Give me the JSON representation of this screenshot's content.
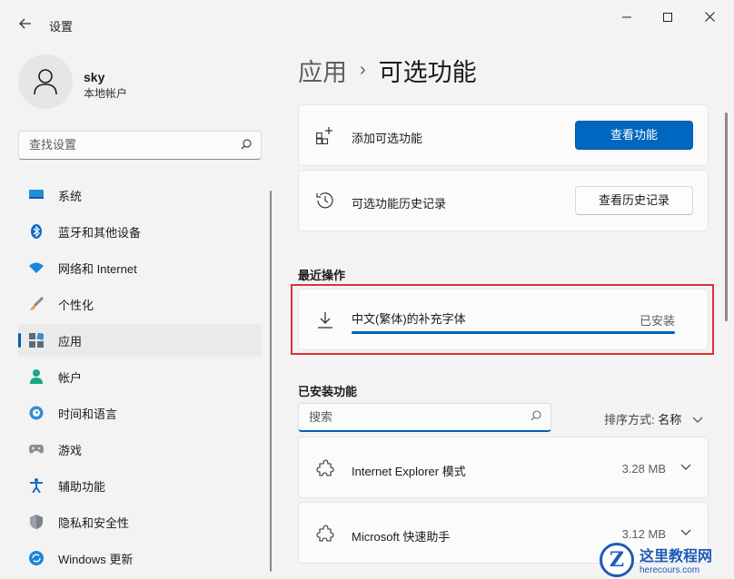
{
  "window": {
    "title": "设置",
    "back_icon": "back-arrow-icon",
    "minimize_glyph": "—",
    "maximize_glyph": "☐",
    "close_glyph": "✕"
  },
  "user": {
    "name": "sky",
    "account": "本地帐户"
  },
  "sidebar": {
    "search_placeholder": "查找设置",
    "items": [
      {
        "label": "系统",
        "icon": "monitor-icon"
      },
      {
        "label": "蓝牙和其他设备",
        "icon": "bluetooth-icon"
      },
      {
        "label": "网络和 Internet",
        "icon": "wifi-icon"
      },
      {
        "label": "个性化",
        "icon": "brush-icon"
      },
      {
        "label": "应用",
        "icon": "apps-icon",
        "active": true
      },
      {
        "label": "帐户",
        "icon": "person-icon"
      },
      {
        "label": "时间和语言",
        "icon": "globe-clock-icon"
      },
      {
        "label": "游戏",
        "icon": "gamepad-icon"
      },
      {
        "label": "辅助功能",
        "icon": "accessibility-icon"
      },
      {
        "label": "隐私和安全性",
        "icon": "shield-icon"
      },
      {
        "label": "Windows 更新",
        "icon": "update-icon"
      }
    ]
  },
  "breadcrumb": {
    "parent": "应用",
    "separator": "›",
    "current": "可选功能"
  },
  "add_feature": {
    "label": "添加可选功能",
    "button": "查看功能",
    "icon": "add-apps-icon"
  },
  "history": {
    "label": "可选功能历史记录",
    "button": "查看历史记录",
    "icon": "history-icon"
  },
  "recent": {
    "heading": "最近操作",
    "item": {
      "name": "中文(繁体)的补充字体",
      "status": "已安装",
      "progress": 1.0,
      "icon": "download-icon"
    }
  },
  "installed": {
    "heading": "已安装功能",
    "search_placeholder": "搜索",
    "sort_label": "排序方式:",
    "sort_value": "名称",
    "items": [
      {
        "name": "Internet Explorer 模式",
        "size": "3.28 MB",
        "icon": "puzzle-icon"
      },
      {
        "name": "Microsoft 快速助手",
        "size": "3.12 MB",
        "icon": "puzzle-icon"
      }
    ]
  },
  "watermark": {
    "logo_letter": "Z",
    "title": "这里教程网",
    "url": "herecours.com"
  },
  "colors": {
    "accent": "#0067c0",
    "highlight_border": "#e03232",
    "background": "#f3f3f3"
  }
}
